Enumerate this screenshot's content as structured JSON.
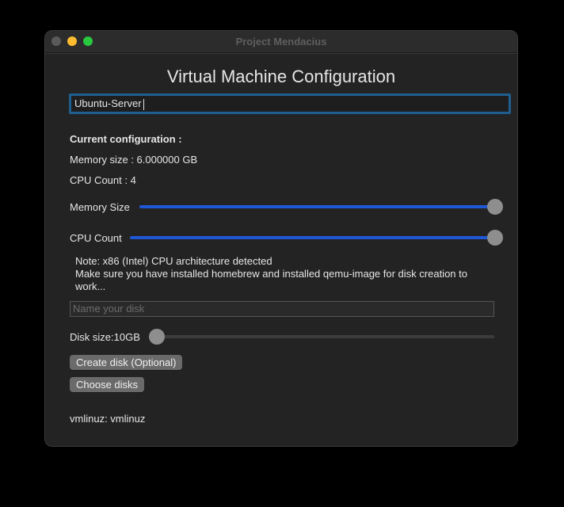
{
  "window": {
    "title": "Project Mendacius"
  },
  "config": {
    "heading": "Virtual Machine Configuration",
    "vm_name": "Ubuntu-Server",
    "current_config_label": "Current configuration :",
    "memory_size_text": "Memory size : 6.000000 GB",
    "cpu_count_text": "CPU Count : 4"
  },
  "sliders": {
    "memory_label": "Memory Size",
    "memory_value_fraction": 1.0,
    "cpu_label": "CPU Count",
    "cpu_value_fraction": 1.0,
    "disk_label": "Disk size:10GB",
    "disk_value_fraction": 0.0
  },
  "note": {
    "line1": "Note: x86 (Intel) CPU architecture detected",
    "line2": "Make sure you have installed homebrew and installed qemu-image for disk creation to work..."
  },
  "disk": {
    "name_placeholder": "Name your disk",
    "create_button": "Create disk (Optional)",
    "choose_button": "Choose disks"
  },
  "kernel": {
    "text": "vmlinuz: vmlinuz"
  },
  "colors": {
    "accent": "#1f58d6",
    "focus_ring": "#1e5f8f",
    "background": "#232323"
  }
}
